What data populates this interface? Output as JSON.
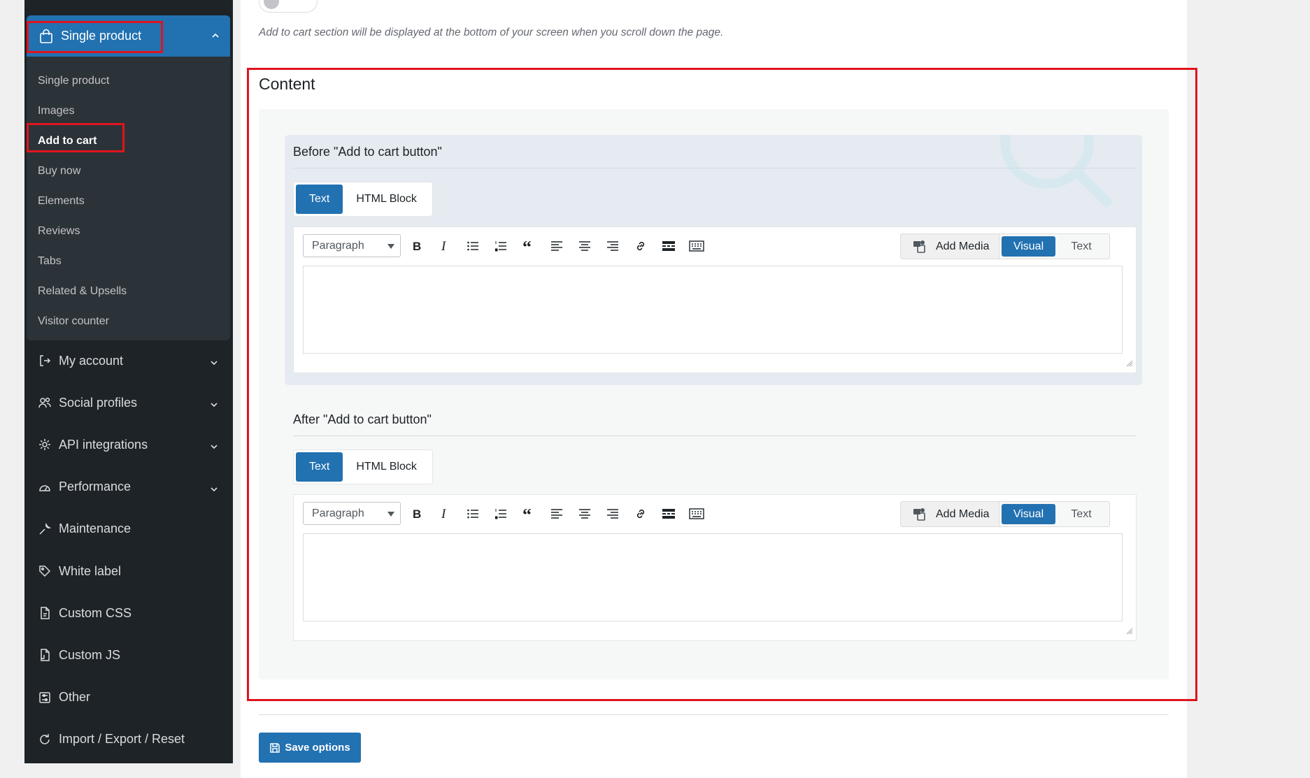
{
  "sidebar": {
    "active_section": {
      "label": "Single product",
      "icon": "shopping-bag-icon"
    },
    "sub_items": [
      {
        "label": "Single product",
        "current": false
      },
      {
        "label": "Images",
        "current": false
      },
      {
        "label": "Add to cart",
        "current": true
      },
      {
        "label": "Buy now",
        "current": false
      },
      {
        "label": "Elements",
        "current": false
      },
      {
        "label": "Reviews",
        "current": false
      },
      {
        "label": "Tabs",
        "current": false
      },
      {
        "label": "Related & Upsells",
        "current": false
      },
      {
        "label": "Visitor counter",
        "current": false
      }
    ],
    "nav_items": [
      {
        "label": "My account",
        "icon": "sign-out-icon",
        "has_chevron": true
      },
      {
        "label": "Social profiles",
        "icon": "users-icon",
        "has_chevron": true
      },
      {
        "label": "API integrations",
        "icon": "gear-icon",
        "has_chevron": true
      },
      {
        "label": "Performance",
        "icon": "gauge-icon",
        "has_chevron": true
      },
      {
        "label": "Maintenance",
        "icon": "wrench-icon",
        "has_chevron": false
      },
      {
        "label": "White label",
        "icon": "tag-icon",
        "has_chevron": false
      },
      {
        "label": "Custom CSS",
        "icon": "css-file-icon",
        "has_chevron": false
      },
      {
        "label": "Custom JS",
        "icon": "js-file-icon",
        "has_chevron": false
      },
      {
        "label": "Other",
        "icon": "sliders-icon",
        "has_chevron": false
      },
      {
        "label": "Import / Export / Reset",
        "icon": "refresh-icon",
        "has_chevron": false
      }
    ]
  },
  "main": {
    "toggle_label": "Off",
    "description": "Add to cart section will be displayed at the bottom of your screen when you scroll down the page.",
    "content_title": "Content",
    "groups": [
      {
        "title": "Before \"Add to cart button\"",
        "tabs": [
          "Text",
          "HTML Block"
        ],
        "active_tab": "Text",
        "editor": {
          "format": "Paragraph",
          "add_media": "Add Media",
          "visual": "Visual",
          "text": "Text",
          "value": ""
        }
      },
      {
        "title": "After \"Add to cart button\"",
        "tabs": [
          "Text",
          "HTML Block"
        ],
        "active_tab": "Text",
        "editor": {
          "format": "Paragraph",
          "add_media": "Add Media",
          "visual": "Visual",
          "text": "Text",
          "value": ""
        }
      }
    ],
    "save_label": "Save options"
  },
  "colors": {
    "accent": "#2271b1",
    "sidebar_bg": "#1d2327",
    "highlight_border": "#e0141e"
  }
}
